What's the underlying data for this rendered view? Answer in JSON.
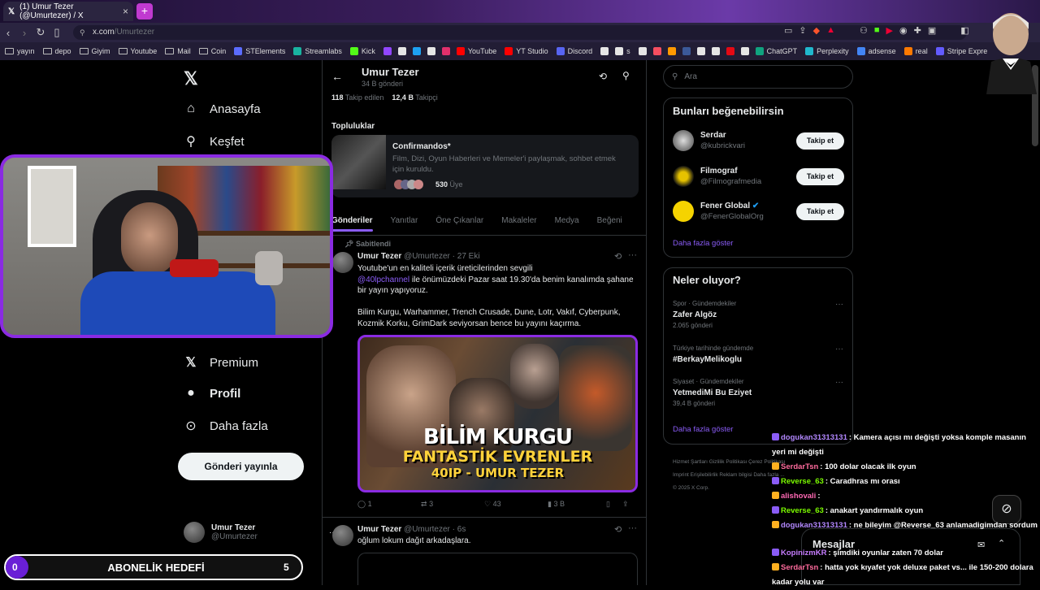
{
  "browser": {
    "tab_title": "(1) Umur Tezer (@Umurtezer) / X",
    "url_domain": "x.com",
    "url_path": "/Umurtezer",
    "bookmarks": [
      "yayın",
      "depo",
      "Giyim",
      "Youtube",
      "Mail",
      "Coin",
      "STElements",
      "Streamlabs",
      "Kick",
      "",
      "",
      "",
      "",
      "",
      "YouTube",
      "YT Studio",
      "Discord",
      "",
      "s",
      "",
      "",
      "",
      "",
      "",
      "",
      "",
      "",
      "ChatGPT",
      "Perplexity",
      "adsense",
      "real",
      "Stripe Expre"
    ],
    "bookmark_colors": [
      "#888",
      "#888",
      "#888",
      "#888",
      "#888",
      "#888",
      "#5b6cff",
      "#19b3a0",
      "#53fc18",
      "#9146ff",
      "#e5e5e5",
      "#1da1f2",
      "#e5e5e5",
      "#e1306c",
      "#ff0000",
      "#ff0000",
      "#5865f2",
      "#e5e5e5",
      "#e5e5e5",
      "#e5e5e5",
      "#f64e60",
      "#ff9900",
      "#3b5998",
      "#e5e5e5",
      "#e5e5e5",
      "#e50914",
      "#e5e5e5",
      "#10a37f",
      "#20b8cd",
      "#4285f4",
      "#ff7a00",
      "#635bff"
    ]
  },
  "left_nav": {
    "items": [
      {
        "label": "Anasayfa",
        "icon": "home-icon"
      },
      {
        "label": "Keşfet",
        "icon": "search-icon"
      },
      {
        "label": "Premium",
        "icon": "x-logo-icon"
      },
      {
        "label": "Profil",
        "icon": "person-icon"
      },
      {
        "label": "Daha fazla",
        "icon": "more-circle-icon"
      }
    ],
    "post_button": "Gönderi yayınla",
    "account": {
      "name": "Umur Tezer",
      "handle": "@Umurtezer"
    }
  },
  "profile": {
    "name": "Umur Tezer",
    "posts_count": "34 B gönderi",
    "following_count": "118",
    "following_label": "Takip edilen",
    "followers_count": "12,4 B",
    "followers_label": "Takipçi",
    "communities_title": "Topluluklar",
    "community": {
      "name": "Confirmandos*",
      "desc": "Film, Dizi, Oyun Haberleri ve Memeler'i paylaşmak, sohbet etmek için kuruldu.",
      "members": "530",
      "members_label": "Üye"
    },
    "tabs": [
      "Gönderiler",
      "Yanıtlar",
      "Öne Çıkanlar",
      "Makaleler",
      "Medya",
      "Beğeni"
    ]
  },
  "posts": [
    {
      "pinned_label": "Sabitlendi",
      "author": "Umur Tezer",
      "handle": "@Umurtezer",
      "date": "· 27 Eki",
      "text1": "Youtube'un en kaliteli içerik üreticilerinden sevgili",
      "mention": "@40lpchannel",
      "text2": " ile önümüzdeki Pazar saat 19.30'da benim kanalımda şahane bir yayın yapıyoruz.",
      "text3": "Bilim Kurgu, Warhammer, Trench Crusade, Dune, Lotr, Vakıf, Cyberpunk, Kozmik Korku, GrimDark seviyorsan bence bu yayını kaçırma.",
      "image_title_1": "BİLİM KURGU",
      "image_title_2": "FANTASTİK EVRENLER",
      "image_title_3": "40IP - UMUR TEZER",
      "replies": "1",
      "reposts": "3",
      "likes": "43",
      "views": "3 B"
    },
    {
      "author": "Umur Tezer",
      "handle": "@Umurtezer",
      "date": "· 6s",
      "text": "oğlum lokum dağıt arkadaşlara."
    }
  ],
  "search_placeholder": "Ara",
  "suggestions": {
    "title": "Bunları beğenebilirsin",
    "users": [
      {
        "name": "Serdar",
        "handle": "@kubrickvari",
        "button": "Takip et"
      },
      {
        "name": "Filmograf",
        "handle": "@Filmografmedia",
        "button": "Takip et"
      },
      {
        "name": "Fener Global",
        "handle": "@FenerGlobalOrg",
        "button": "Takip et"
      }
    ],
    "more": "Daha fazla göster"
  },
  "trends": {
    "title": "Neler oluyor?",
    "items": [
      {
        "context": "Spor · Gündemdekiler",
        "name": "Zafer Algöz",
        "count": "2.065 gönderi"
      },
      {
        "context": "Türkiye tarihinde gündemde",
        "name": "#BerkayMelikoglu",
        "count": ""
      },
      {
        "context": "Siyaset · Gündemdekiler",
        "name": "YetmediMi Bu Eziyet",
        "count": "39,4 B gönderi"
      }
    ],
    "more": "Daha fazla göster"
  },
  "footer": {
    "line1": "Hizmet Şartları   Gizlilik Politikası   Çerez Politikası",
    "line2": "Imprint   Erişilebilirlik   Reklam bilgisi   Daha fazla ...",
    "line3": "© 2025 X Corp."
  },
  "messages_label": "Mesajlar",
  "chat": [
    {
      "user": "dogukan31313131",
      "color": "#b388ff",
      "text": ": Kamera açısı mı değişti yoksa komple masanın yeri mi değişti"
    },
    {
      "user": "SerdarTsn",
      "color": "#ff6b9d",
      "text": ": 100 dolar olacak ilk oyun"
    },
    {
      "user": "Reverse_63",
      "color": "#7cfc00",
      "text": ": Caradhras mı orası"
    },
    {
      "user": "alishovali",
      "color": "#ff69b4",
      "text": ":"
    },
    {
      "user": "Reverse_63",
      "color": "#7cfc00",
      "text": ": anakart yandırmalık oyun"
    },
    {
      "user": "dogukan31313131",
      "color": "#b388ff",
      "text": ": ne bileyim @Reverse_63 anlamadigimdan sordum"
    },
    {
      "user": "KopinizmKR",
      "color": "#c77dff",
      "text": ": şimdiki oyunlar zaten 70 dolar"
    },
    {
      "user": "SerdarTsn",
      "color": "#ff6b9d",
      "text": ": hatta yok kıyafet yok deluxe paket vs... ile 150-200 dolara kadar yolu var"
    }
  ],
  "sub_goal": {
    "current": "0",
    "label": "ABONELİK HEDEFİ",
    "target": "5"
  }
}
